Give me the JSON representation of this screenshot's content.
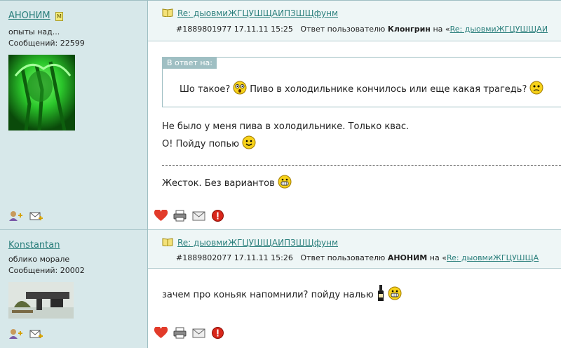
{
  "posts": [
    {
      "author": {
        "name": "АНОНИМ",
        "badge": "M",
        "status": "опыты над...",
        "messages": "Сообщений: 22599",
        "avatar_icon": "green-predator-avatar"
      },
      "topic_title": "Re: дыовмиЖГЦУШЩАИПЗШЩфунм",
      "meta": {
        "id_time": "#1889801977 17.11.11 15:25",
        "reply_prefix": "Ответ пользователю",
        "reply_user": "Клонгрин",
        "reply_on": "на «",
        "reply_link": "Re: дыовмиЖГЦУШЩАИ"
      },
      "quote": {
        "label": "В ответ на:",
        "text_a": "Шо такое?",
        "text_b": "Пиво в холодильнике кончилось или еще какая трагедь?"
      },
      "lines": [
        "Не было у меня пива в холодильнике. Только квас.",
        "О! Пойду попью"
      ],
      "signature": "Жесток. Без вариантов"
    },
    {
      "author": {
        "name": "Konstantan",
        "status": "облико морале",
        "messages": "Сообщений: 20002",
        "avatar_icon": "helmet-and-gun-avatar"
      },
      "topic_title": "Re: дыовмиЖГЦУШЩАИПЗШЩфунм",
      "meta": {
        "id_time": "#1889802077 17.11.11 15:26",
        "reply_prefix": "Ответ пользователю",
        "reply_user": "АНОНИМ",
        "reply_on": "на «",
        "reply_link": "Re: дыовмиЖГЦУШЩА"
      },
      "text": "зачем про коньяк напомнили? пойду налью"
    }
  ],
  "colors": {
    "accent": "#2b7f7c",
    "sidebar": "#d7e8ea",
    "header": "#eef6f6",
    "quote_label": "#9fbfc3"
  }
}
